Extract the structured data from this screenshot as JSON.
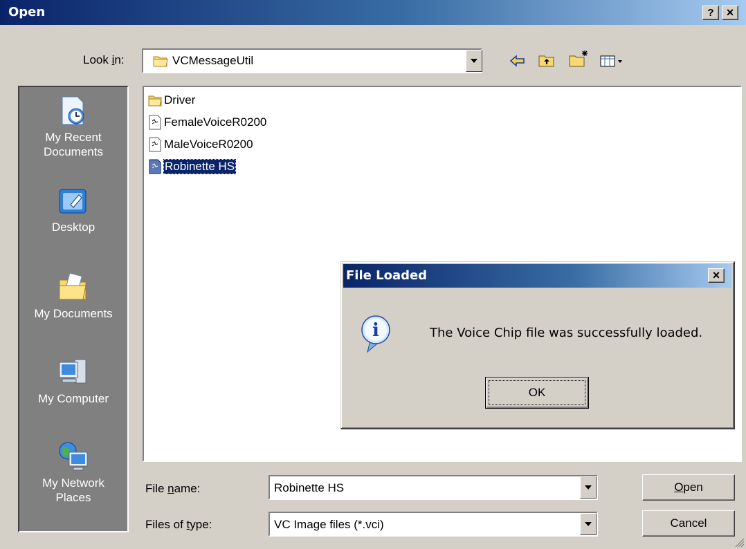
{
  "window": {
    "title": "Open",
    "help_label": "?",
    "close_label": "×"
  },
  "lookin": {
    "label_pre": "Look ",
    "label_key": "i",
    "label_post": "n:",
    "value": "VCMessageUtil"
  },
  "toolbar": {
    "back_icon": "back-arrow-icon",
    "up_icon": "up-folder-icon",
    "newfolder_icon": "new-folder-icon",
    "views_icon": "views-menu-icon"
  },
  "places": [
    {
      "line1": "My Recent",
      "line2": "Documents",
      "icon": "recent-documents-icon"
    },
    {
      "line1": "Desktop",
      "line2": "",
      "icon": "desktop-icon"
    },
    {
      "line1": "My Documents",
      "line2": "",
      "icon": "my-documents-icon"
    },
    {
      "line1": "My Computer",
      "line2": "",
      "icon": "my-computer-icon"
    },
    {
      "line1": "My Network",
      "line2": "Places",
      "icon": "network-places-icon"
    }
  ],
  "files": [
    {
      "name": "Driver",
      "type": "folder",
      "selected": false
    },
    {
      "name": "FemaleVoiceR0200",
      "type": "file",
      "selected": false
    },
    {
      "name": "MaleVoiceR0200",
      "type": "file",
      "selected": false
    },
    {
      "name": "Robinette HS",
      "type": "file",
      "selected": true
    }
  ],
  "filename": {
    "label_pre": "File ",
    "label_key": "n",
    "label_post": "ame:",
    "value": "Robinette HS"
  },
  "filetype": {
    "label_pre": "Files of ",
    "label_key": "t",
    "label_post": "ype:",
    "value": "VC Image files (*.vci)"
  },
  "buttons": {
    "open_key": "O",
    "open_rest": "pen",
    "cancel": "Cancel"
  },
  "message": {
    "title": "File Loaded",
    "text": "The Voice Chip file was successfully loaded.",
    "ok": "OK",
    "close_label": "×",
    "icon": "info-icon"
  }
}
